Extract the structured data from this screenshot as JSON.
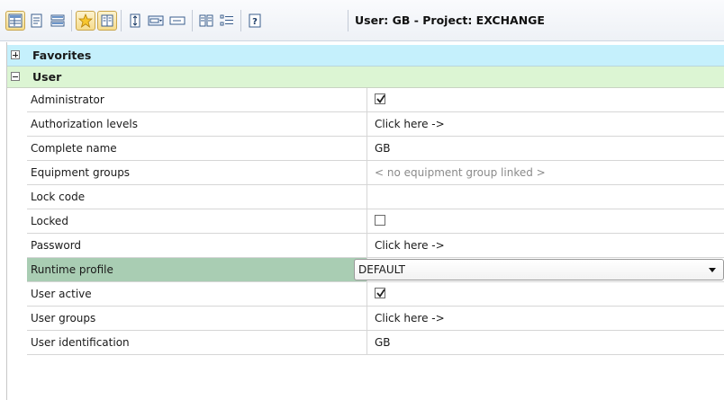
{
  "toolbar": {
    "title": "User: GB - Project: EXCHANGE",
    "buttons": [
      {
        "name": "grid-view-icon",
        "pressed": true
      },
      {
        "name": "form-view-icon",
        "pressed": false
      },
      {
        "name": "list-view-icon",
        "pressed": false
      },
      {
        "name": "favorites-star-icon",
        "pressed": true
      },
      {
        "name": "book-icon",
        "pressed": true
      },
      {
        "name": "sort-icon",
        "pressed": false
      },
      {
        "name": "combo-view-icon",
        "pressed": false
      },
      {
        "name": "field-view-icon",
        "pressed": false
      },
      {
        "name": "columns-icon",
        "pressed": false
      },
      {
        "name": "tree-icon",
        "pressed": false
      },
      {
        "name": "help-icon",
        "pressed": false
      }
    ]
  },
  "groups": {
    "favorites": {
      "label": "Favorites",
      "expanded": false
    },
    "user": {
      "label": "User",
      "expanded": true
    }
  },
  "properties": [
    {
      "name": "Administrator",
      "value": "",
      "type": "checkbox",
      "checked": true
    },
    {
      "name": "Authorization levels",
      "value": "Click here ->",
      "type": "link"
    },
    {
      "name": "Complete name",
      "value": "GB",
      "type": "text"
    },
    {
      "name": "Equipment groups",
      "value": "< no equipment group linked >",
      "type": "placeholder"
    },
    {
      "name": "Lock code",
      "value": "",
      "type": "text"
    },
    {
      "name": "Locked",
      "value": "",
      "type": "checkbox",
      "checked": false
    },
    {
      "name": "Password",
      "value": "Click here ->",
      "type": "link"
    },
    {
      "name": "Runtime profile",
      "value": "DEFAULT",
      "type": "dropdown",
      "selected": true
    },
    {
      "name": "User active",
      "value": "",
      "type": "checkbox",
      "checked": true
    },
    {
      "name": "User groups",
      "value": "Click here ->",
      "type": "link"
    },
    {
      "name": "User identification",
      "value": "GB",
      "type": "text"
    }
  ],
  "colors": {
    "favorites_row": "#c5f0fc",
    "user_row": "#dcf5d3",
    "selected_row": "#a9cdb3",
    "pressed_button": "#f6dc8c"
  }
}
